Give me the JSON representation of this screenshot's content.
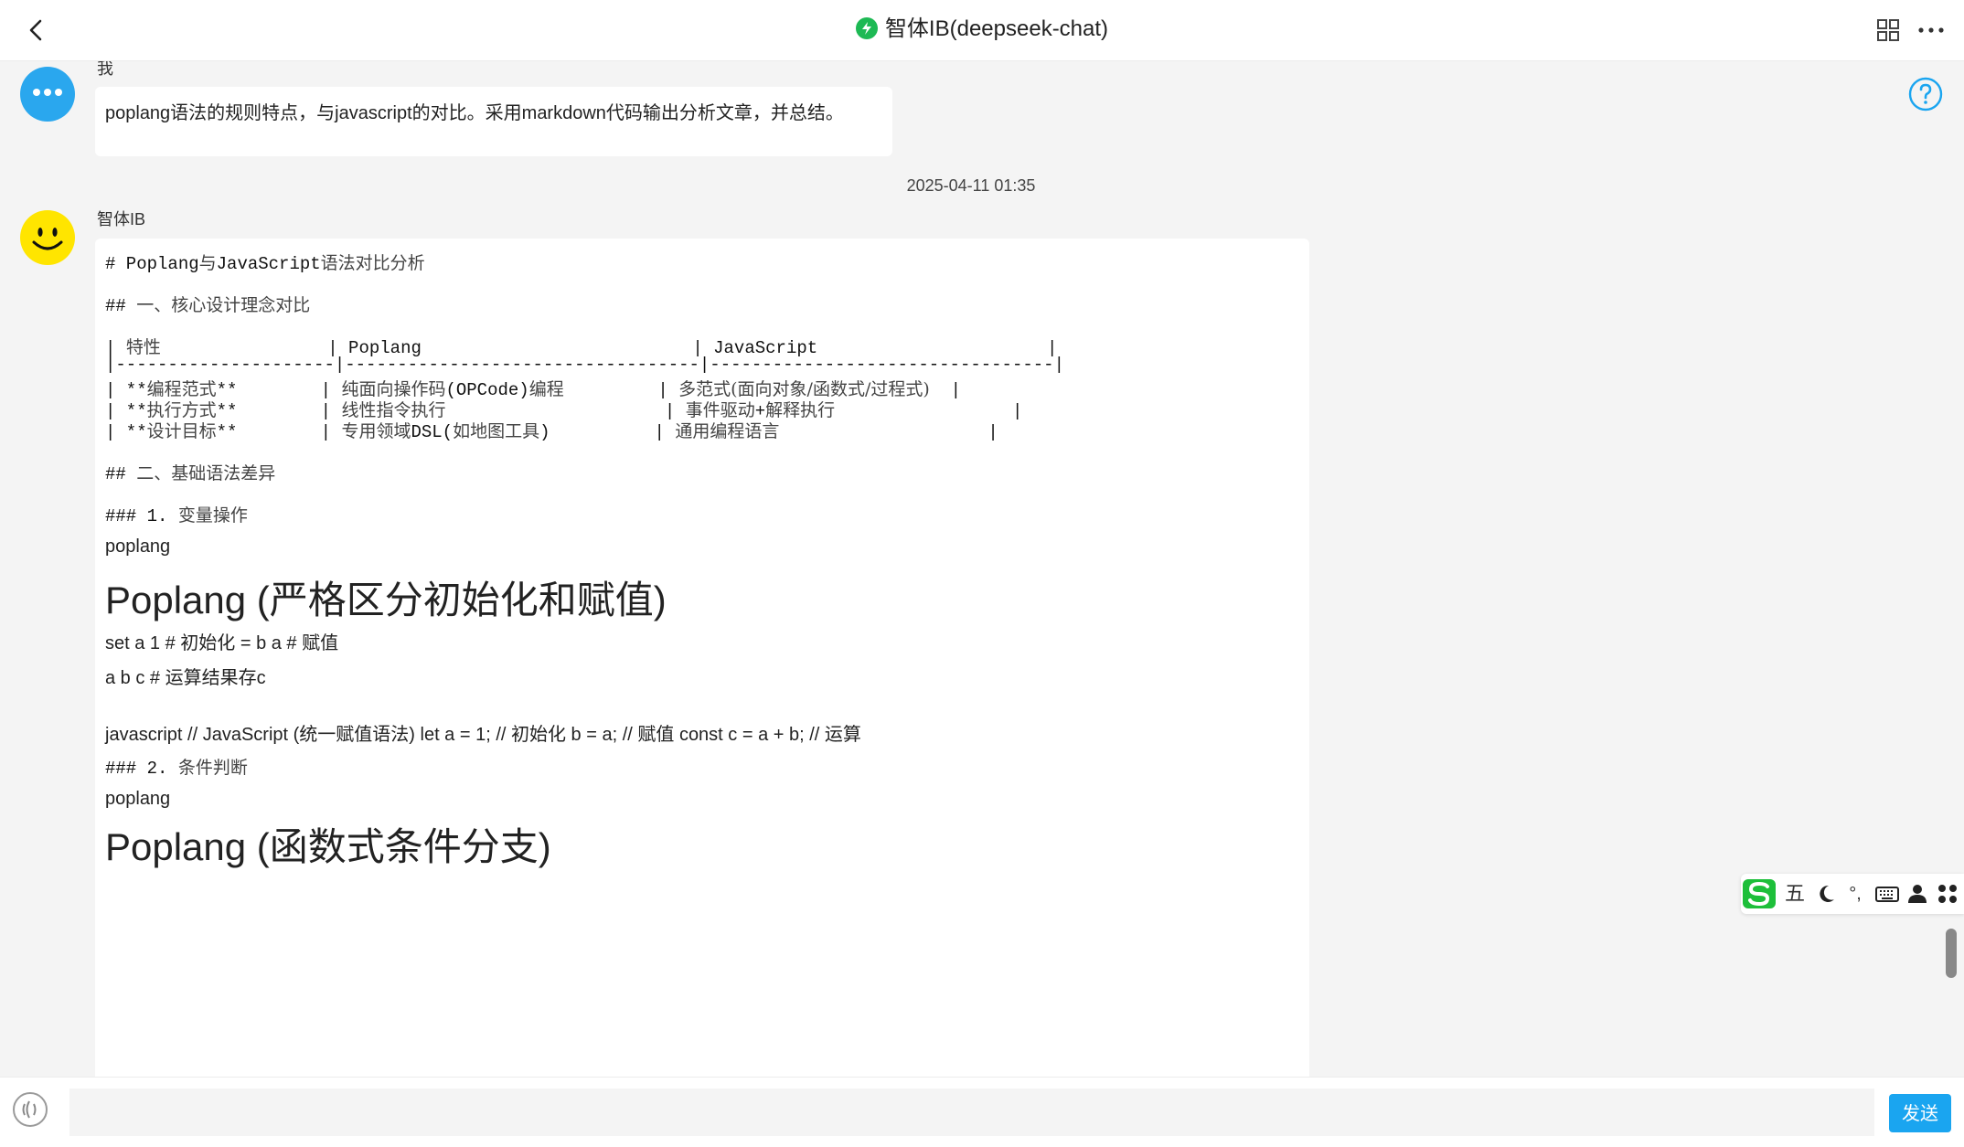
{
  "header": {
    "title": "智体IB(deepseek-chat)",
    "back_icon": "back-arrow-icon",
    "status_icon": "lightning-icon",
    "grid_icon": "grid-icon",
    "more_icon": "more-icon",
    "help_icon": "help-icon"
  },
  "colors": {
    "accent": "#1aa5f0",
    "status": "#1db954",
    "bot_avatar": "#ffe500",
    "user_avatar": "#2aa7ee"
  },
  "user_message": {
    "sender": "我",
    "text": "poplang语法的规则特点，与javascript的对比。采用markdown代码输出分析文章，并总结。"
  },
  "timestamp": "2025-04-11 01:35",
  "bot_message": {
    "sender": "智体IB",
    "lines": [
      {
        "kind": "md",
        "parts": [
          {
            "t": "# Poplang"
          },
          {
            "t": "与",
            "zh": true
          },
          {
            "t": "JavaScript"
          },
          {
            "t": "语法对比分析",
            "zh": true
          }
        ]
      },
      {
        "kind": "md",
        "parts": [
          {
            "t": "## "
          },
          {
            "t": "一、核心设计理念对比",
            "zh": true
          }
        ]
      },
      {
        "kind": "md",
        "parts": [
          {
            "t": "| "
          },
          {
            "t": "特性",
            "zh": true
          },
          {
            "t": "                | Poplang                          | JavaScript                      |"
          }
        ]
      },
      {
        "kind": "md",
        "parts": [
          {
            "t": "|---------------------|----------------------------------|---------------------------------|"
          }
        ]
      },
      {
        "kind": "md",
        "parts": [
          {
            "t": "| **"
          },
          {
            "t": "编程范式",
            "zh": true
          },
          {
            "t": "**        | "
          },
          {
            "t": "纯面向操作码",
            "zh": true
          },
          {
            "t": "(OPCode)"
          },
          {
            "t": "编程",
            "zh": true
          },
          {
            "t": "         | "
          },
          {
            "t": "多范式(面向对象/函数式/过程式)",
            "zh": true
          },
          {
            "t": "  |"
          }
        ]
      },
      {
        "kind": "md",
        "parts": [
          {
            "t": "| **"
          },
          {
            "t": "执行方式",
            "zh": true
          },
          {
            "t": "**        | "
          },
          {
            "t": "线性指令执行",
            "zh": true
          },
          {
            "t": "                     | "
          },
          {
            "t": "事件驱动",
            "zh": true
          },
          {
            "t": "+"
          },
          {
            "t": "解释执行",
            "zh": true
          },
          {
            "t": "                 |"
          }
        ]
      },
      {
        "kind": "md",
        "parts": [
          {
            "t": "| **"
          },
          {
            "t": "设计目标",
            "zh": true
          },
          {
            "t": "**        | "
          },
          {
            "t": "专用领域",
            "zh": true
          },
          {
            "t": "DSL("
          },
          {
            "t": "如地图工具",
            "zh": true
          },
          {
            "t": ")          | "
          },
          {
            "t": "通用编程语言",
            "zh": true
          },
          {
            "t": "                    |"
          }
        ]
      },
      {
        "kind": "md",
        "parts": [
          {
            "t": "## "
          },
          {
            "t": "二、基础语法差异",
            "zh": true
          }
        ]
      },
      {
        "kind": "md",
        "parts": [
          {
            "t": "### 1. "
          },
          {
            "t": "变量操作",
            "zh": true
          }
        ]
      },
      {
        "kind": "para",
        "text": "poplang"
      },
      {
        "kind": "h1",
        "text": "Poplang (严格区分初始化和赋值)"
      },
      {
        "kind": "para",
        "text": "set a 1 # 初始化 = b a # 赋值"
      },
      {
        "kind": "para",
        "text": "a b c # 运算结果存c"
      },
      {
        "kind": "para",
        "text": "javascript // JavaScript (统一赋值语法) let a = 1; // 初始化 b = a; // 赋值 const c = a + b; // 运算"
      },
      {
        "kind": "md",
        "parts": [
          {
            "t": "### 2. "
          },
          {
            "t": "条件判断",
            "zh": true
          }
        ]
      },
      {
        "kind": "para",
        "text": "poplang"
      },
      {
        "kind": "h1",
        "text": "Poplang (函数式条件分支)"
      }
    ]
  },
  "ime_toolbar": {
    "logo_icon": "sogou-s-icon",
    "mode_label": "五",
    "moon_icon": "moon-icon",
    "punct_label": "°,",
    "keyboard_icon": "keyboard-icon",
    "user_icon": "user-icon",
    "apps_icon": "apps-icon"
  },
  "input_bar": {
    "voice_icon": "voice-icon",
    "placeholder": "",
    "send_label": "发送"
  }
}
